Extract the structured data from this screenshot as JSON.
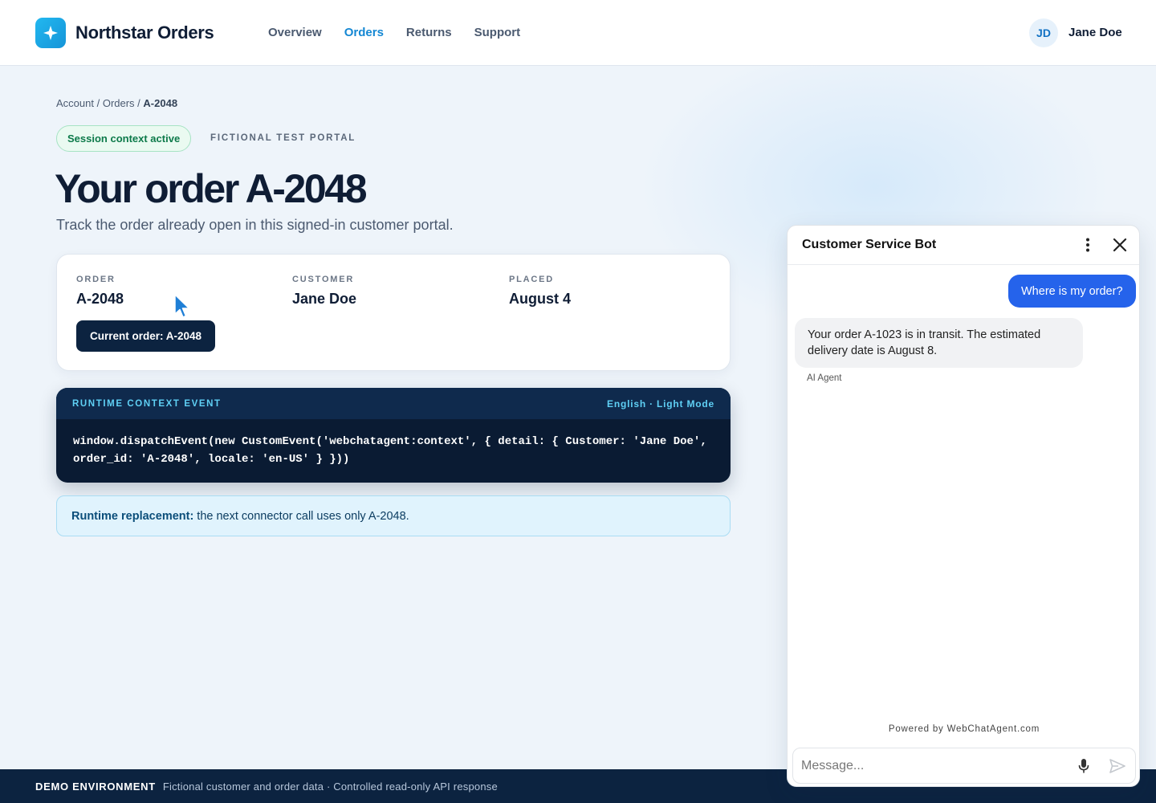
{
  "header": {
    "brand": "Northstar Orders",
    "logo_icon": "sparkle-icon",
    "nav": [
      {
        "label": "Overview",
        "active": false
      },
      {
        "label": "Orders",
        "active": true
      },
      {
        "label": "Returns",
        "active": false
      },
      {
        "label": "Support",
        "active": false
      }
    ],
    "user": {
      "initials": "JD",
      "name": "Jane Doe"
    }
  },
  "breadcrumb": {
    "parts": [
      "Account",
      "Orders"
    ],
    "separator": " / ",
    "current": "A-2048"
  },
  "badges": {
    "session": "Session context active",
    "portal": "FICTIONAL TEST PORTAL"
  },
  "page": {
    "title": "Your order A-2048",
    "subtitle": "Track the order already open in this signed-in customer portal."
  },
  "order_card": {
    "fields": [
      {
        "label": "ORDER",
        "value": "A-2048"
      },
      {
        "label": "CUSTOMER",
        "value": "Jane Doe"
      },
      {
        "label": "PLACED",
        "value": "August 4"
      }
    ],
    "button_label": "Current order: A-2048"
  },
  "event_panel": {
    "title": "RUNTIME CONTEXT EVENT",
    "mode": "English · Light Mode",
    "code_line1": "window.dispatchEvent(new CustomEvent('webchatagent:context', { detail: { Customer: 'Jane Doe',",
    "code_line2": "order_id: 'A-2048', locale: 'en-US' } }))"
  },
  "runtime_note": {
    "label": "Runtime replacement:",
    "text": "the next connector call uses only A-2048."
  },
  "footer": {
    "tag": "DEMO ENVIRONMENT",
    "text": "Fictional customer and order data · Controlled read-only API response"
  },
  "chat": {
    "title": "Customer Service Bot",
    "menu_icon": "more-vertical-icon",
    "close_icon": "close-icon",
    "user_message": "Where is my order?",
    "bot_message": "Your order A-1023 is in transit. The estimated delivery date is August 8.",
    "bot_sender": "AI Agent",
    "powered_by": "Powered by WebChatAgent.com",
    "input_placeholder": "Message...",
    "mic_icon": "microphone-icon",
    "send_icon": "send-icon"
  },
  "colors": {
    "accent": "#1487d3",
    "navy": "#0c2340",
    "chat_user_bubble": "#2563eb",
    "success": "#0d7a4a"
  }
}
